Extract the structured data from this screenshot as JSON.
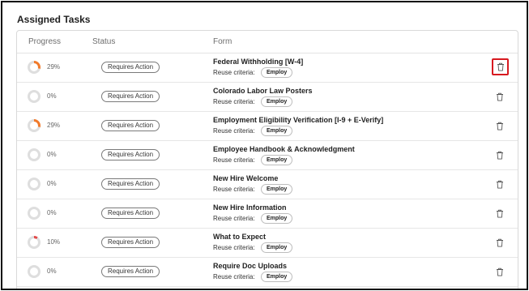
{
  "section": {
    "title": "Assigned Tasks"
  },
  "columns": {
    "progress": "Progress",
    "status": "Status",
    "form": "Form"
  },
  "rows": [
    {
      "progress_label": "29%",
      "progress_value": 29,
      "status": "Requires Action",
      "form_title": "Federal Withholding [W-4]",
      "reuse_label": "Reuse criteria:",
      "reuse_value": "Employ",
      "delete_highlighted": true
    },
    {
      "progress_label": "0%",
      "progress_value": 0,
      "status": "Requires Action",
      "form_title": "Colorado Labor Law Posters",
      "reuse_label": "Reuse criteria:",
      "reuse_value": "Employ",
      "delete_highlighted": false
    },
    {
      "progress_label": "29%",
      "progress_value": 29,
      "status": "Requires Action",
      "form_title": "Employment Eligibility Verification [I-9 + E-Verify]",
      "reuse_label": "Reuse criteria:",
      "reuse_value": "Employ",
      "delete_highlighted": false
    },
    {
      "progress_label": "0%",
      "progress_value": 0,
      "status": "Requires Action",
      "form_title": "Employee Handbook & Acknowledgment",
      "reuse_label": "Reuse criteria:",
      "reuse_value": "Employ",
      "delete_highlighted": false
    },
    {
      "progress_label": "0%",
      "progress_value": 0,
      "status": "Requires Action",
      "form_title": "New Hire Welcome",
      "reuse_label": "Reuse criteria:",
      "reuse_value": "Employ",
      "delete_highlighted": false
    },
    {
      "progress_label": "0%",
      "progress_value": 0,
      "status": "Requires Action",
      "form_title": "New Hire Information",
      "reuse_label": "Reuse criteria:",
      "reuse_value": "Employ",
      "delete_highlighted": false
    },
    {
      "progress_label": "10%",
      "progress_value": 10,
      "status": "Requires Action",
      "form_title": "What to Expect",
      "reuse_label": "Reuse criteria:",
      "reuse_value": "Employ",
      "delete_highlighted": false
    },
    {
      "progress_label": "0%",
      "progress_value": 0,
      "status": "Requires Action",
      "form_title": "Require Doc Uploads",
      "reuse_label": "Reuse criteria:",
      "reuse_value": "Employ",
      "delete_highlighted": false
    }
  ],
  "icons": {
    "delete": "trash-icon"
  },
  "colors": {
    "progress_fill": "#f07a2b",
    "progress_low": "#e24b4b",
    "progress_track": "#dedede",
    "highlight": "#d71920"
  }
}
